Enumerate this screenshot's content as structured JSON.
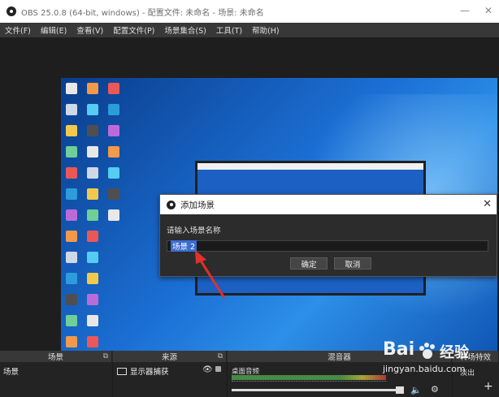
{
  "window": {
    "title": "OBS 25.0.8 (64-bit, windows) - 配置文件: 未命名 - 场景: 未命名",
    "minimize_glyph": "—",
    "close_glyph": "✕"
  },
  "menu": {
    "items": [
      "文件(F)",
      "编辑(E)",
      "查看(V)",
      "配置文件(P)",
      "场景集合(S)",
      "工具(T)",
      "帮助(H)"
    ]
  },
  "dialog": {
    "title": "添加场景",
    "close_glyph": "✕",
    "prompt": "请输入场景名称",
    "input_value": "场景 2",
    "ok_label": "确定",
    "cancel_label": "取消"
  },
  "docks": {
    "scenes": {
      "title": "场景",
      "items": [
        "场景"
      ]
    },
    "sources": {
      "title": "来源",
      "items": [
        "显示器捕获"
      ]
    },
    "mixer": {
      "title": "混音器",
      "track_label": "桌面音频"
    },
    "transitions": {
      "title": "转场特效",
      "partial_label": "淡出"
    }
  },
  "watermark": {
    "brand": "Bai",
    "brand2": "经验",
    "url": "jingyan.baidu.com"
  },
  "colors": {
    "accent_arrow": "#e0312b",
    "selection": "#3b6ccf",
    "desktop": "#1b6fd4"
  },
  "icons": [
    "obs-logo-icon",
    "monitor-icon",
    "eye-icon",
    "lock-icon",
    "speaker-icon",
    "gear-icon",
    "plus-icon",
    "popout-icon"
  ]
}
